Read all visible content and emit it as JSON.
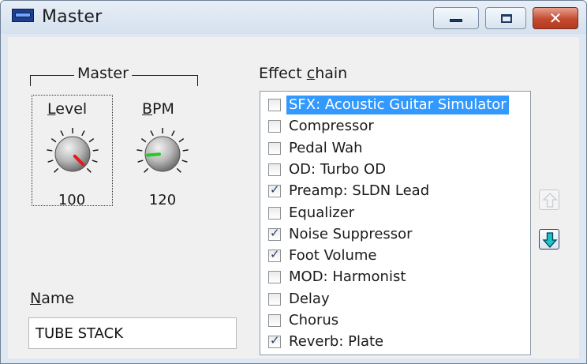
{
  "window": {
    "title": "Master",
    "close_glyph": "✕",
    "icons": {
      "app": "device-icon",
      "minimize": "minimize-icon",
      "maximize": "maximize-icon",
      "close": "close-icon"
    }
  },
  "master_group": {
    "title": "Master",
    "level": {
      "label_u": "L",
      "label_rest": "evel",
      "value": "100",
      "position": 1.0,
      "pointer_color": "#e8191c"
    },
    "bpm": {
      "label_u": "B",
      "label_rest": "PM",
      "value": "120",
      "position": 0.15,
      "pointer_color": "#22cc22"
    }
  },
  "name_field": {
    "label_u": "N",
    "label_rest": "ame",
    "value": "TUBE STACK"
  },
  "effect_chain": {
    "label_pre": "Effect ",
    "label_u": "c",
    "label_rest": "hain",
    "selected_index": 0,
    "items": [
      {
        "label": "SFX: Acoustic Guitar Simulator",
        "checked": false
      },
      {
        "label": "Compressor",
        "checked": false
      },
      {
        "label": "Pedal Wah",
        "checked": false
      },
      {
        "label": "OD: Turbo OD",
        "checked": false
      },
      {
        "label": "Preamp: SLDN Lead",
        "checked": true
      },
      {
        "label": "Equalizer",
        "checked": false
      },
      {
        "label": "Noise Suppressor",
        "checked": true
      },
      {
        "label": "Foot Volume",
        "checked": true
      },
      {
        "label": "MOD: Harmonist",
        "checked": false
      },
      {
        "label": "Delay",
        "checked": false
      },
      {
        "label": "Chorus",
        "checked": false
      },
      {
        "label": "Reverb: Plate",
        "checked": true
      }
    ],
    "move_up": {
      "icon": "arrow-up-icon",
      "enabled": false
    },
    "move_down": {
      "icon": "arrow-down-icon",
      "enabled": true,
      "color": "#18c7c4"
    }
  }
}
